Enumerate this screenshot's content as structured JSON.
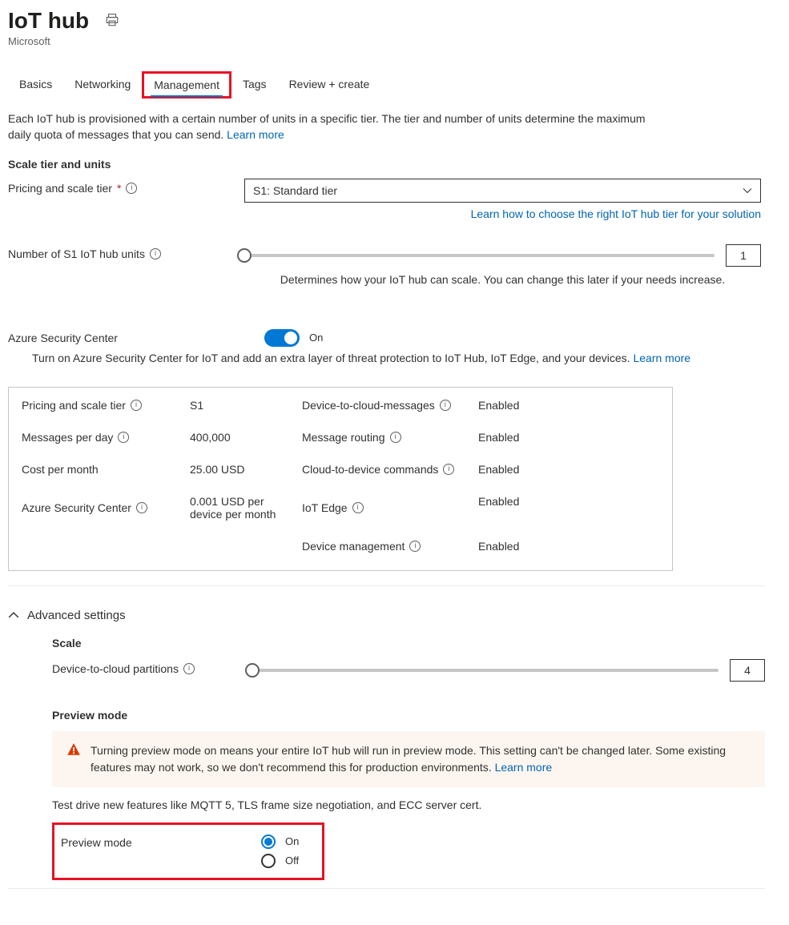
{
  "header": {
    "title": "IoT hub",
    "subtitle": "Microsoft"
  },
  "tabs": {
    "items": [
      "Basics",
      "Networking",
      "Management",
      "Tags",
      "Review + create"
    ],
    "active_index": 2
  },
  "intro": {
    "text": "Each IoT hub is provisioned with a certain number of units in a specific tier. The tier and number of units determine the maximum daily quota of messages that you can send.",
    "learn_more": "Learn more"
  },
  "scale": {
    "heading": "Scale tier and units",
    "pricing_label": "Pricing and scale tier",
    "pricing_value": "S1: Standard tier",
    "tier_help_link": "Learn how to choose the right IoT hub tier for your solution",
    "units_label": "Number of S1 IoT hub units",
    "units_value": "1",
    "units_help": "Determines how your IoT hub can scale. You can change this later if your needs increase."
  },
  "security": {
    "label": "Azure Security Center",
    "state": "On",
    "desc": "Turn on Azure Security Center for IoT and add an extra layer of threat protection to IoT Hub, IoT Edge, and your devices.",
    "learn_more": "Learn more"
  },
  "summary": {
    "left": [
      {
        "label": "Pricing and scale tier",
        "value": "S1",
        "info": true
      },
      {
        "label": "Messages per day",
        "value": "400,000",
        "info": true
      },
      {
        "label": "Cost per month",
        "value": "25.00 USD",
        "info": false
      },
      {
        "label": "Azure Security Center",
        "value": "0.001 USD per device per month",
        "info": true
      }
    ],
    "right": [
      {
        "label": "Device-to-cloud-messages",
        "value": "Enabled"
      },
      {
        "label": "Message routing",
        "value": "Enabled"
      },
      {
        "label": "Cloud-to-device commands",
        "value": "Enabled"
      },
      {
        "label": "IoT Edge",
        "value": "Enabled"
      },
      {
        "label": "Device management",
        "value": "Enabled"
      }
    ]
  },
  "advanced": {
    "title": "Advanced settings",
    "scale_heading": "Scale",
    "partitions_label": "Device-to-cloud partitions",
    "partitions_value": "4",
    "preview_heading": "Preview mode",
    "preview_warning": "Turning preview mode on means your entire IoT hub will run in preview mode. This setting can't be changed later. Some existing features may not work, so we don't recommend this for production environments.",
    "preview_learn_more": "Learn more",
    "preview_desc": "Test drive new features like MQTT 5, TLS frame size negotiation, and ECC server cert.",
    "preview_field_label": "Preview mode",
    "radio_on": "On",
    "radio_off": "Off"
  }
}
